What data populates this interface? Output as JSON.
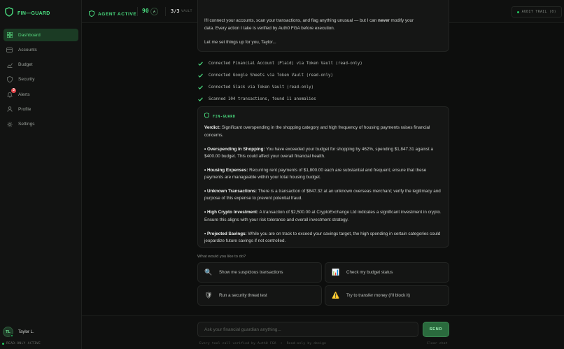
{
  "brand": {
    "name": "FIN—GUARD"
  },
  "sidebar": {
    "items": [
      {
        "label": "Dashboard",
        "icon": "grid-icon",
        "active": true
      },
      {
        "label": "Accounts",
        "icon": "wallet-icon"
      },
      {
        "label": "Budget",
        "icon": "bar-chart-icon"
      },
      {
        "label": "Security",
        "icon": "shield-icon"
      },
      {
        "label": "Alerts",
        "icon": "bell-icon",
        "badge": "3"
      },
      {
        "label": "Profile",
        "icon": "user-icon"
      },
      {
        "label": "Settings",
        "icon": "gear-icon"
      }
    ],
    "user": {
      "initials": "TL",
      "name": "Taylor L."
    },
    "status": "READ-ONLY ACTIVE"
  },
  "topbar": {
    "agent_status": "AGENT ACTIVE",
    "score": "90",
    "grade": "A",
    "vault_count": "3/3",
    "vault_label": "VAULT",
    "audit_trail": "AUDIT TRAIL (0)"
  },
  "intro": {
    "line1_pre": "I'll connect your accounts, scan your transactions, and flag anything unusual — but I can ",
    "line1_bold": "never",
    "line1_post": " modify your",
    "line2": "data. Every action I take is verified by Auth0 FGA before execution.",
    "line3": "Let me set things up for you, Taylor..."
  },
  "steps": [
    "Connected Financial Account (Plaid) via Token Vault (read-only)",
    "Connected Google Sheets via Token Vault (read-only)",
    "Connected Slack via Token Vault (read-only)",
    "Scanned 104 transactions, found 11 anomalies"
  ],
  "verdict": {
    "header": "FIN-GUARD",
    "paragraphs": [
      {
        "title": "Verdict:",
        "bullet": "",
        "text": " Significant overspending in the shopping category and high frequency of housing payments raises financial concerns."
      },
      {
        "title": "Overspending in Shopping:",
        "bullet": "• ",
        "text": " You have exceeded your budget for shopping by 462%, spending $1,847.31 against a $400.00 budget. This could affect your overall financial health."
      },
      {
        "title": "Housing Expenses:",
        "bullet": "• ",
        "text": " Recurring rent payments of $1,800.00 each are substantial and frequent; ensure that these payments are manageable within your total housing budget."
      },
      {
        "title": "Unknown Transactions:",
        "bullet": "• ",
        "text": " There is a transaction of $847.32 at an unknown overseas merchant; verify the legitimacy and purpose of this expense to prevent potential fraud."
      },
      {
        "title": "High Crypto Investment:",
        "bullet": "• ",
        "text": " A transaction of $2,500.00 at CryptoExchange Ltd indicates a significant investment in crypto. Ensure this aligns with your risk tolerance and overall investment strategy."
      },
      {
        "title": "Projected Savings:",
        "bullet": "• ",
        "text": " While you are on track to exceed your savings target, the high spending in certain categories could jeopardize future savings if not controlled."
      }
    ]
  },
  "prompt_question": "What would you like to do?",
  "suggestions": [
    {
      "label": "Show me suspicious transactions",
      "icon": "🔍"
    },
    {
      "label": "Check my budget status",
      "icon": "📊"
    },
    {
      "label": "Run a security threat test",
      "icon": "🛡"
    },
    {
      "label": "Try to transfer money (I'll block it)",
      "icon": "⚠️"
    }
  ],
  "input": {
    "placeholder": "Ask your financial guardian anything..."
  },
  "send_label": "SEND",
  "footer": {
    "note1": "Every tool call verified by Auth0 FGA",
    "bullet": "•",
    "note2": "Read-only by design",
    "clear_chat": "Clear chat"
  },
  "colors": {
    "accent": "#4ade80",
    "active_bg": "#1b3b24",
    "badge": "#e5484d",
    "send_bg": "#2a6a3d"
  }
}
